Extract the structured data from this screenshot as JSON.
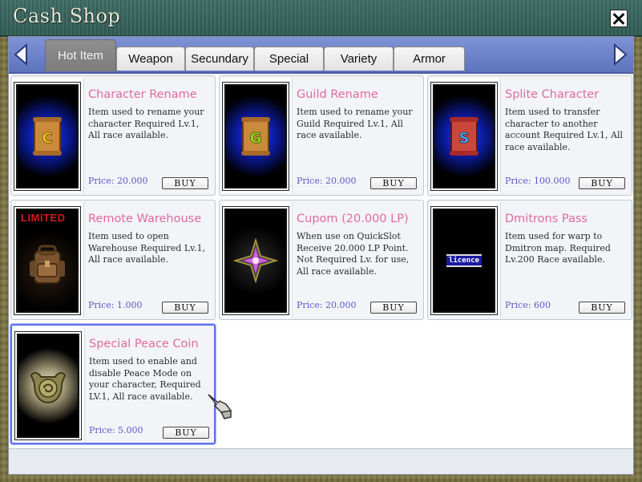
{
  "window": {
    "title": "Cash Shop"
  },
  "tabs": [
    {
      "label": "Hot Item",
      "active": true
    },
    {
      "label": "Weapon",
      "active": false
    },
    {
      "label": "Secundary",
      "active": false
    },
    {
      "label": "Special",
      "active": false
    },
    {
      "label": "Variety",
      "active": false
    },
    {
      "label": "Armor",
      "active": false
    }
  ],
  "items": [
    {
      "name": "Character Rename",
      "desc": "Item used to rename your character Required Lv.1, All race available.",
      "price": "Price: 20.000",
      "buy": "BUY",
      "icon": "scroll-icon",
      "icon_letter": "C"
    },
    {
      "name": "Guild Rename",
      "desc": "Item used to rename your Guild Required Lv.1, All race available.",
      "price": "Price: 20.000",
      "buy": "BUY",
      "icon": "scroll-icon",
      "icon_letter": "G"
    },
    {
      "name": "Splite Character",
      "desc": "Item used to transfer character to another account Required Lv.1, All race available.",
      "price": "Price: 100.000",
      "buy": "BUY",
      "icon": "scroll-icon",
      "icon_letter": "S"
    },
    {
      "name": "Remote Warehouse",
      "desc": "Item used to open Warehouse Required Lv.1, All race available.",
      "price": "Price: 1.000",
      "buy": "BUY",
      "icon": "backpack-icon",
      "badge": "LIMITED"
    },
    {
      "name": "Cupom  (20.000 LP)",
      "desc": "When use on QuickSlot Receive 20.000 LP Point. Not Required Lv. for use, All race available.",
      "price": "Price: 20.000",
      "buy": "BUY",
      "icon": "star-emblem-icon"
    },
    {
      "name": "Dmitrons Pass",
      "desc": "Item used for warp to Dmitron map. Required Lv.200 Race available.",
      "price": "Price: 600",
      "buy": "BUY",
      "icon": "licence-icon",
      "icon_text": "licence"
    },
    {
      "name": "Special Peace Coin",
      "desc": "Item used to enable and disable Peace Mode on your character, Required LV.1, All race available.",
      "price": "Price: 5.000",
      "buy": "BUY",
      "icon": "coin-icon",
      "selected": true
    }
  ],
  "colors": {
    "item_name": "#e06aa0",
    "price": "#5a5ac8",
    "tabstrip": "#6f83cc",
    "selection": "#5f72ee"
  }
}
